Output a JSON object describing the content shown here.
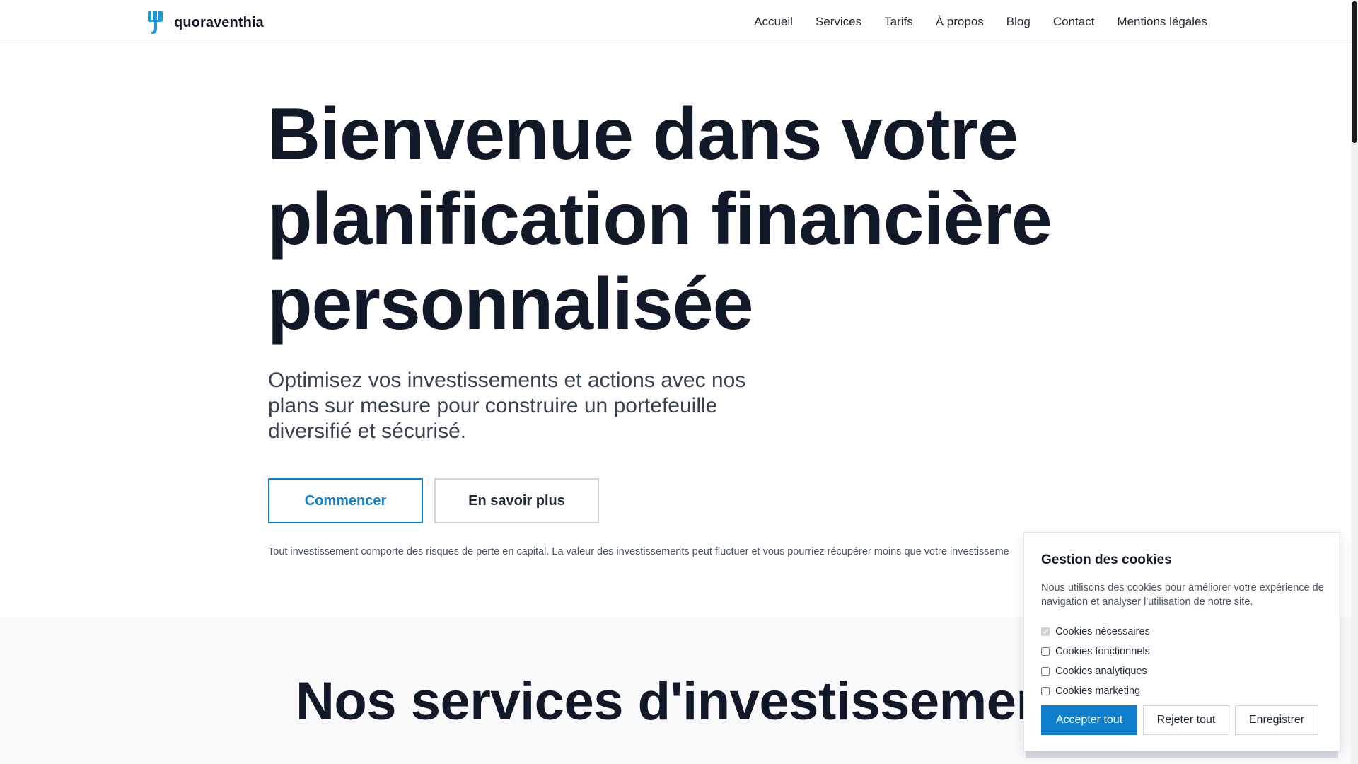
{
  "brand": {
    "name": "quoraventhia",
    "logo_icon": "elephant-logo-icon",
    "logo_color": "#1a9ad6"
  },
  "nav": {
    "items": [
      {
        "label": "Accueil"
      },
      {
        "label": "Services"
      },
      {
        "label": "Tarifs"
      },
      {
        "label": "À propos"
      },
      {
        "label": "Blog"
      },
      {
        "label": "Contact"
      },
      {
        "label": "Mentions légales"
      }
    ]
  },
  "hero": {
    "title_lines": [
      "Bienvenue dans votre",
      "planification financière",
      "personnalisée"
    ],
    "subtitle": "Optimisez vos investissements et actions avec nos plans sur mesure pour construire un portefeuille diversifié et sécurisé.",
    "primary_button": "Commencer",
    "secondary_button": "En savoir plus",
    "disclaimer": "Tout investissement comporte des risques de perte en capital. La valeur des investissements peut fluctuer et vous pourriez récupérer moins que votre investisseme"
  },
  "services": {
    "title": "Nos services d'investissemen"
  },
  "cookies": {
    "title": "Gestion des cookies",
    "description": "Nous utilisons des cookies pour améliorer votre expérience de navigation et analyser l'utilisation de notre site.",
    "options": [
      {
        "label": "Cookies nécessaires",
        "checked": true,
        "disabled": true
      },
      {
        "label": "Cookies fonctionnels",
        "checked": false,
        "disabled": false
      },
      {
        "label": "Cookies analytiques",
        "checked": false,
        "disabled": false
      },
      {
        "label": "Cookies marketing",
        "checked": false,
        "disabled": false
      }
    ],
    "accept_label": "Accepter tout",
    "reject_label": "Rejeter tout",
    "save_label": "Enregistrer"
  },
  "colors": {
    "accent": "#0f7fce",
    "heading": "#111827",
    "section_bg": "#f8f9fb"
  }
}
